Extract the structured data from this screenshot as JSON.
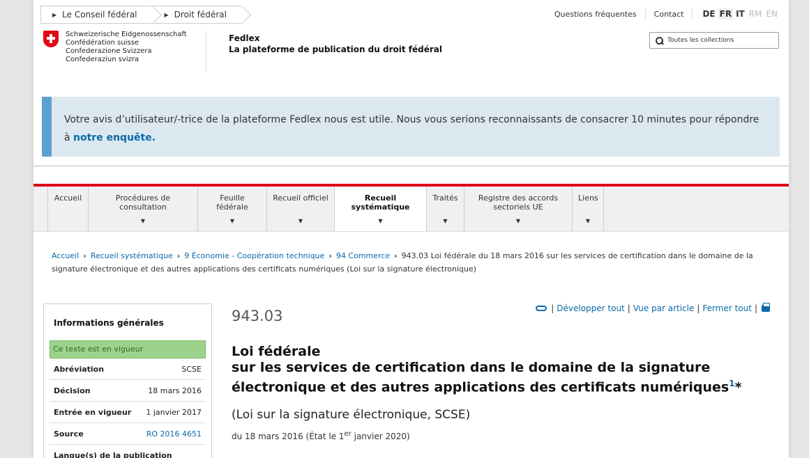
{
  "top_breadcrumb": [
    "Le Conseil fédéral",
    "Droit fédéral"
  ],
  "top_links": {
    "faq": "Questions fréquentes",
    "contact": "Contact"
  },
  "languages": [
    "DE",
    "FR",
    "IT",
    "RM",
    "EN"
  ],
  "active_language": "FR",
  "logo_lines": [
    "Schweizerische Eidgenossenschaft",
    "Confédération suisse",
    "Confederazione Svizzera",
    "Confederaziun svizra"
  ],
  "site": {
    "name": "Fedlex",
    "tagline": "La plateforme de publication du droit fédéral"
  },
  "search": {
    "placeholder": "Toutes les collections"
  },
  "notice": {
    "text": "Votre avis d’utilisateur/-trice de la plateforme Fedlex nous est utile. Nous vous serions reconnaissants de consacrer 10 minutes pour répondre à ",
    "link": "notre enquête."
  },
  "nav": [
    {
      "label": "Accueil"
    },
    {
      "label": "Procédures de consultation"
    },
    {
      "label": "Feuille fédérale"
    },
    {
      "label": "Recueil officiel"
    },
    {
      "label": "Recueil systématique"
    },
    {
      "label": "Traités"
    },
    {
      "label": "Registre des accords sectoriels UE"
    },
    {
      "label": "Liens"
    }
  ],
  "breadcrumb": {
    "home": "Accueil",
    "rs": "Recueil systématique",
    "cat": "9 Économie - Coopération technique",
    "sub": "94 Commerce",
    "current": "943.03 Loi fédérale du 18 mars 2016 sur les services de certification dans le domaine de la signature électronique et des autres applications des certificats numériques (Loi sur la signature électronique)"
  },
  "sidebar": {
    "title": "Informations générales",
    "status": "Ce texte est en vigueur",
    "rows": [
      {
        "key": "Abréviation",
        "value": "SCSE"
      },
      {
        "key": "Décision",
        "value": "18 mars 2016"
      },
      {
        "key": "Entrée en vigueur",
        "value": "1 janvier 2017"
      },
      {
        "key": "Source",
        "value": "RO 2016 4651"
      },
      {
        "key": "Langue(s) de la publication",
        "value": ""
      }
    ]
  },
  "content": {
    "sr_number": "943.03",
    "tools": {
      "expand": "Développer tout",
      "per_article": "Vue par article",
      "close": "Fermer tout"
    },
    "title_line1": "Loi fédérale",
    "title_line2": "sur les services de certification dans le domaine de la signature électronique et des autres applications des certificats numériques",
    "footnote": "1",
    "asterisk": "*",
    "subtitle": "(Loi sur la signature électronique, SCSE)",
    "date_prefix": "du 18 mars 2016 (État le 1",
    "date_sup": "er",
    "date_suffix": " janvier 2020)"
  },
  "colors": {
    "accent": "#0a6aa8",
    "red": "#dc0018",
    "notice_bg": "#dce8ef",
    "notice_border": "#5aa1d1",
    "status_green": "#9cd38a"
  }
}
